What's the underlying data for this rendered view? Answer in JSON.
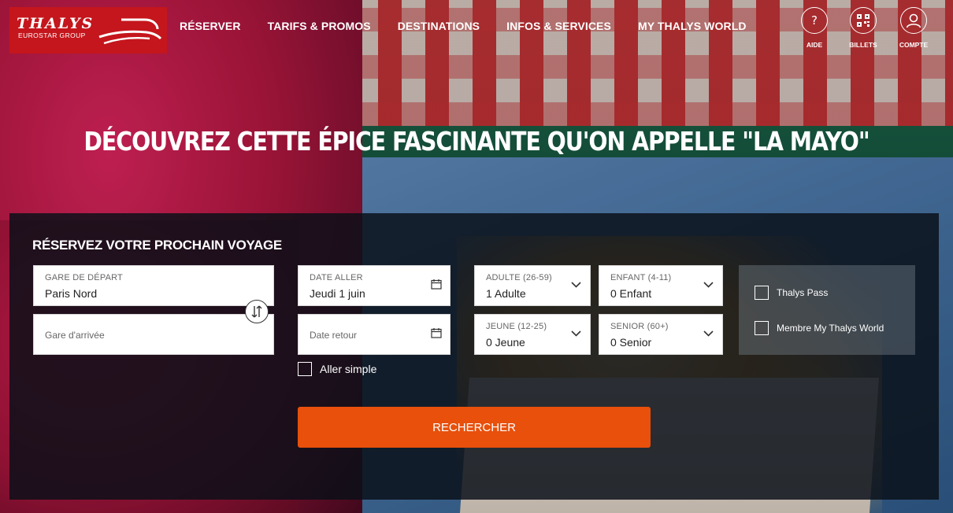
{
  "brand": {
    "name": "THALYS",
    "sub": "EUROSTAR GROUP",
    "color": "#c4161c"
  },
  "nav": [
    "RÉSERVER",
    "TARIFS & PROMOS",
    "DESTINATIONS",
    "INFOS & SERVICES",
    "MY THALYS WORLD"
  ],
  "utility": [
    {
      "label": "AIDE",
      "icon": "help-icon"
    },
    {
      "label": "BILLETS",
      "icon": "qr-code-icon"
    },
    {
      "label": "COMPTE",
      "icon": "user-icon"
    }
  ],
  "hero": {
    "title": "DÉCOUVREZ CETTE ÉPICE FASCINANTE QU'ON APPELLE \"LA MAYO\""
  },
  "booking": {
    "title": "RÉSERVEZ VOTRE PROCHAIN VOYAGE",
    "departure": {
      "label": "GARE DE DÉPART",
      "value": "Paris Nord"
    },
    "arrival": {
      "placeholder": "Gare d'arrivée"
    },
    "date_out": {
      "label": "DATE ALLER",
      "value": "Jeudi 1 juin"
    },
    "date_return": {
      "placeholder": "Date retour"
    },
    "one_way": {
      "label": "Aller simple",
      "checked": false
    },
    "adult": {
      "label": "ADULTE (26-59)",
      "value": "1 Adulte"
    },
    "child": {
      "label": "ENFANT (4-11)",
      "value": "0 Enfant"
    },
    "youth": {
      "label": "JEUNE (12-25)",
      "value": "0 Jeune"
    },
    "senior": {
      "label": "SENIOR (60+)",
      "value": "0 Senior"
    },
    "thalys_pass": {
      "label": "Thalys Pass",
      "checked": false
    },
    "member": {
      "label": "Membre My Thalys World",
      "checked": false
    },
    "search_label": "RECHERCHER",
    "accent": "#e8500c"
  }
}
